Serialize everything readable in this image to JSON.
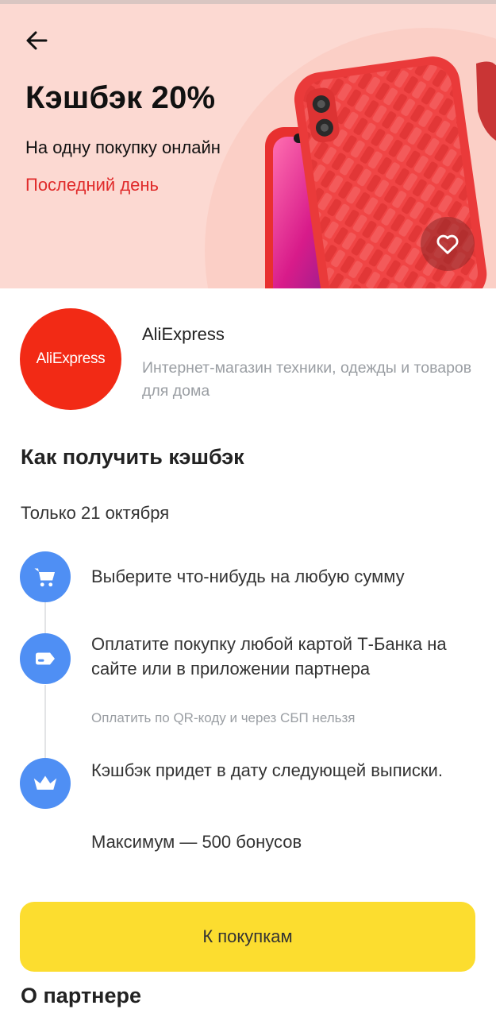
{
  "hero": {
    "back_icon": "arrow-left-icon",
    "title": "Кэшбэк 20%",
    "subtitle": "На одну покупку онлайн",
    "deadline": "Последний день",
    "favorite_icon": "heart-icon",
    "colors": {
      "background": "#fcd9d2",
      "deadline": "#e02b2b"
    }
  },
  "partner": {
    "logo_text": "AliExpress",
    "logo_color": "#f22a15",
    "name": "AliExpress",
    "description": "Интернет-магазин техники, одежды и товаров для дома"
  },
  "how": {
    "title": "Как получить кэшбэк",
    "only_date": "Только 21 октября",
    "steps": [
      {
        "icon": "cart-icon",
        "text": "Выберите что-нибудь на любую сумму"
      },
      {
        "icon": "card-icon",
        "text": "Оплатите покупку любой картой Т-Банка на сайте или в приложении партнера",
        "note": "Оплатить по QR-коду и через СБП нельзя"
      },
      {
        "icon": "crown-icon",
        "text": "Кэшбэк придет в дату следующей выписки.",
        "extra": "Максимум — 500 бонусов"
      }
    ]
  },
  "cta": {
    "label": "К покупкам",
    "color": "#fcdd2f"
  },
  "about": {
    "title": "О партнере"
  }
}
